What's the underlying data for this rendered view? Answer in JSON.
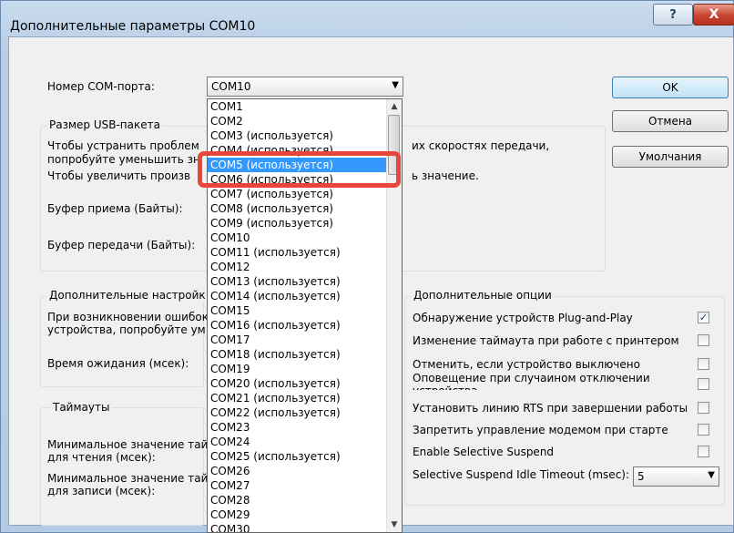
{
  "window": {
    "title": "Дополнительные параметры COM10",
    "help_glyph": "?",
    "close_glyph": "X"
  },
  "port": {
    "label": "Номер COM-порта:",
    "selected": "COM10",
    "options": [
      "COM1",
      "COM2",
      "COM3 (используется)",
      "COM4 (используется)",
      "COM5 (используется)",
      "COM6 (используется)",
      "COM7 (используется)",
      "COM8 (используется)",
      "COM9 (используется)",
      "COM10",
      "COM11 (используется)",
      "COM12",
      "COM13 (используется)",
      "COM14 (используется)",
      "COM15",
      "COM16 (используется)",
      "COM17",
      "COM18 (используется)",
      "COM19",
      "COM20 (используется)",
      "COM21 (используется)",
      "COM22 (используется)",
      "COM23",
      "COM24",
      "COM25 (используется)",
      "COM26",
      "COM27",
      "COM28",
      "COM29",
      "COM30"
    ],
    "highlighted": "COM5 (используется)"
  },
  "buttons": {
    "ok": "OK",
    "cancel": "Отмена",
    "defaults": "Умолчания"
  },
  "usb": {
    "title": "Размер USB-пакета",
    "line1": "Чтобы устранить проблемы при низких скоростях передачи,",
    "line1_right": "их скоростях передачи,",
    "line1_left": "Чтобы устранить проблем",
    "line2_left": "попробуйте уменьшить зн",
    "line3_left": "Чтобы увеличить произв",
    "line3_right": "ь значение.",
    "rx_label": "Буфер приема (Байты):",
    "tx_label": "Буфер передачи (Байты):"
  },
  "advanced": {
    "title": "Дополнительные настройк",
    "line1": "При возникновении ошибок",
    "line2": "устройства, попробуйте ум",
    "timeout_label": "Время ожидания (мсек):"
  },
  "timeouts": {
    "title": "Таймауты",
    "read1": "Минимальное значение тай",
    "read2": "для чтения (мсек):",
    "write1": "Минимальное значение тай",
    "write2": "для записи (мсек):"
  },
  "options": {
    "title": "Дополнительные опции",
    "items": [
      {
        "label": "Обнаружение устройств Plug-and-Play",
        "checked": true
      },
      {
        "label": "Изменение таймаута при работе с принтером",
        "checked": false
      },
      {
        "label": "Отменить, если устройство выключено",
        "checked": false
      },
      {
        "label": "Оповещение при случаином отключении устройства",
        "checked": false
      },
      {
        "label": "Установить линию RTS при завершении работы",
        "checked": false
      },
      {
        "label": "Запретить управление модемом при старте",
        "checked": false
      },
      {
        "label": "Enable Selective Suspend",
        "checked": false
      }
    ],
    "suspend_label": "Selective Suspend Idle Timeout (msec):",
    "suspend_value": "5",
    "check_glyph": "✓"
  }
}
